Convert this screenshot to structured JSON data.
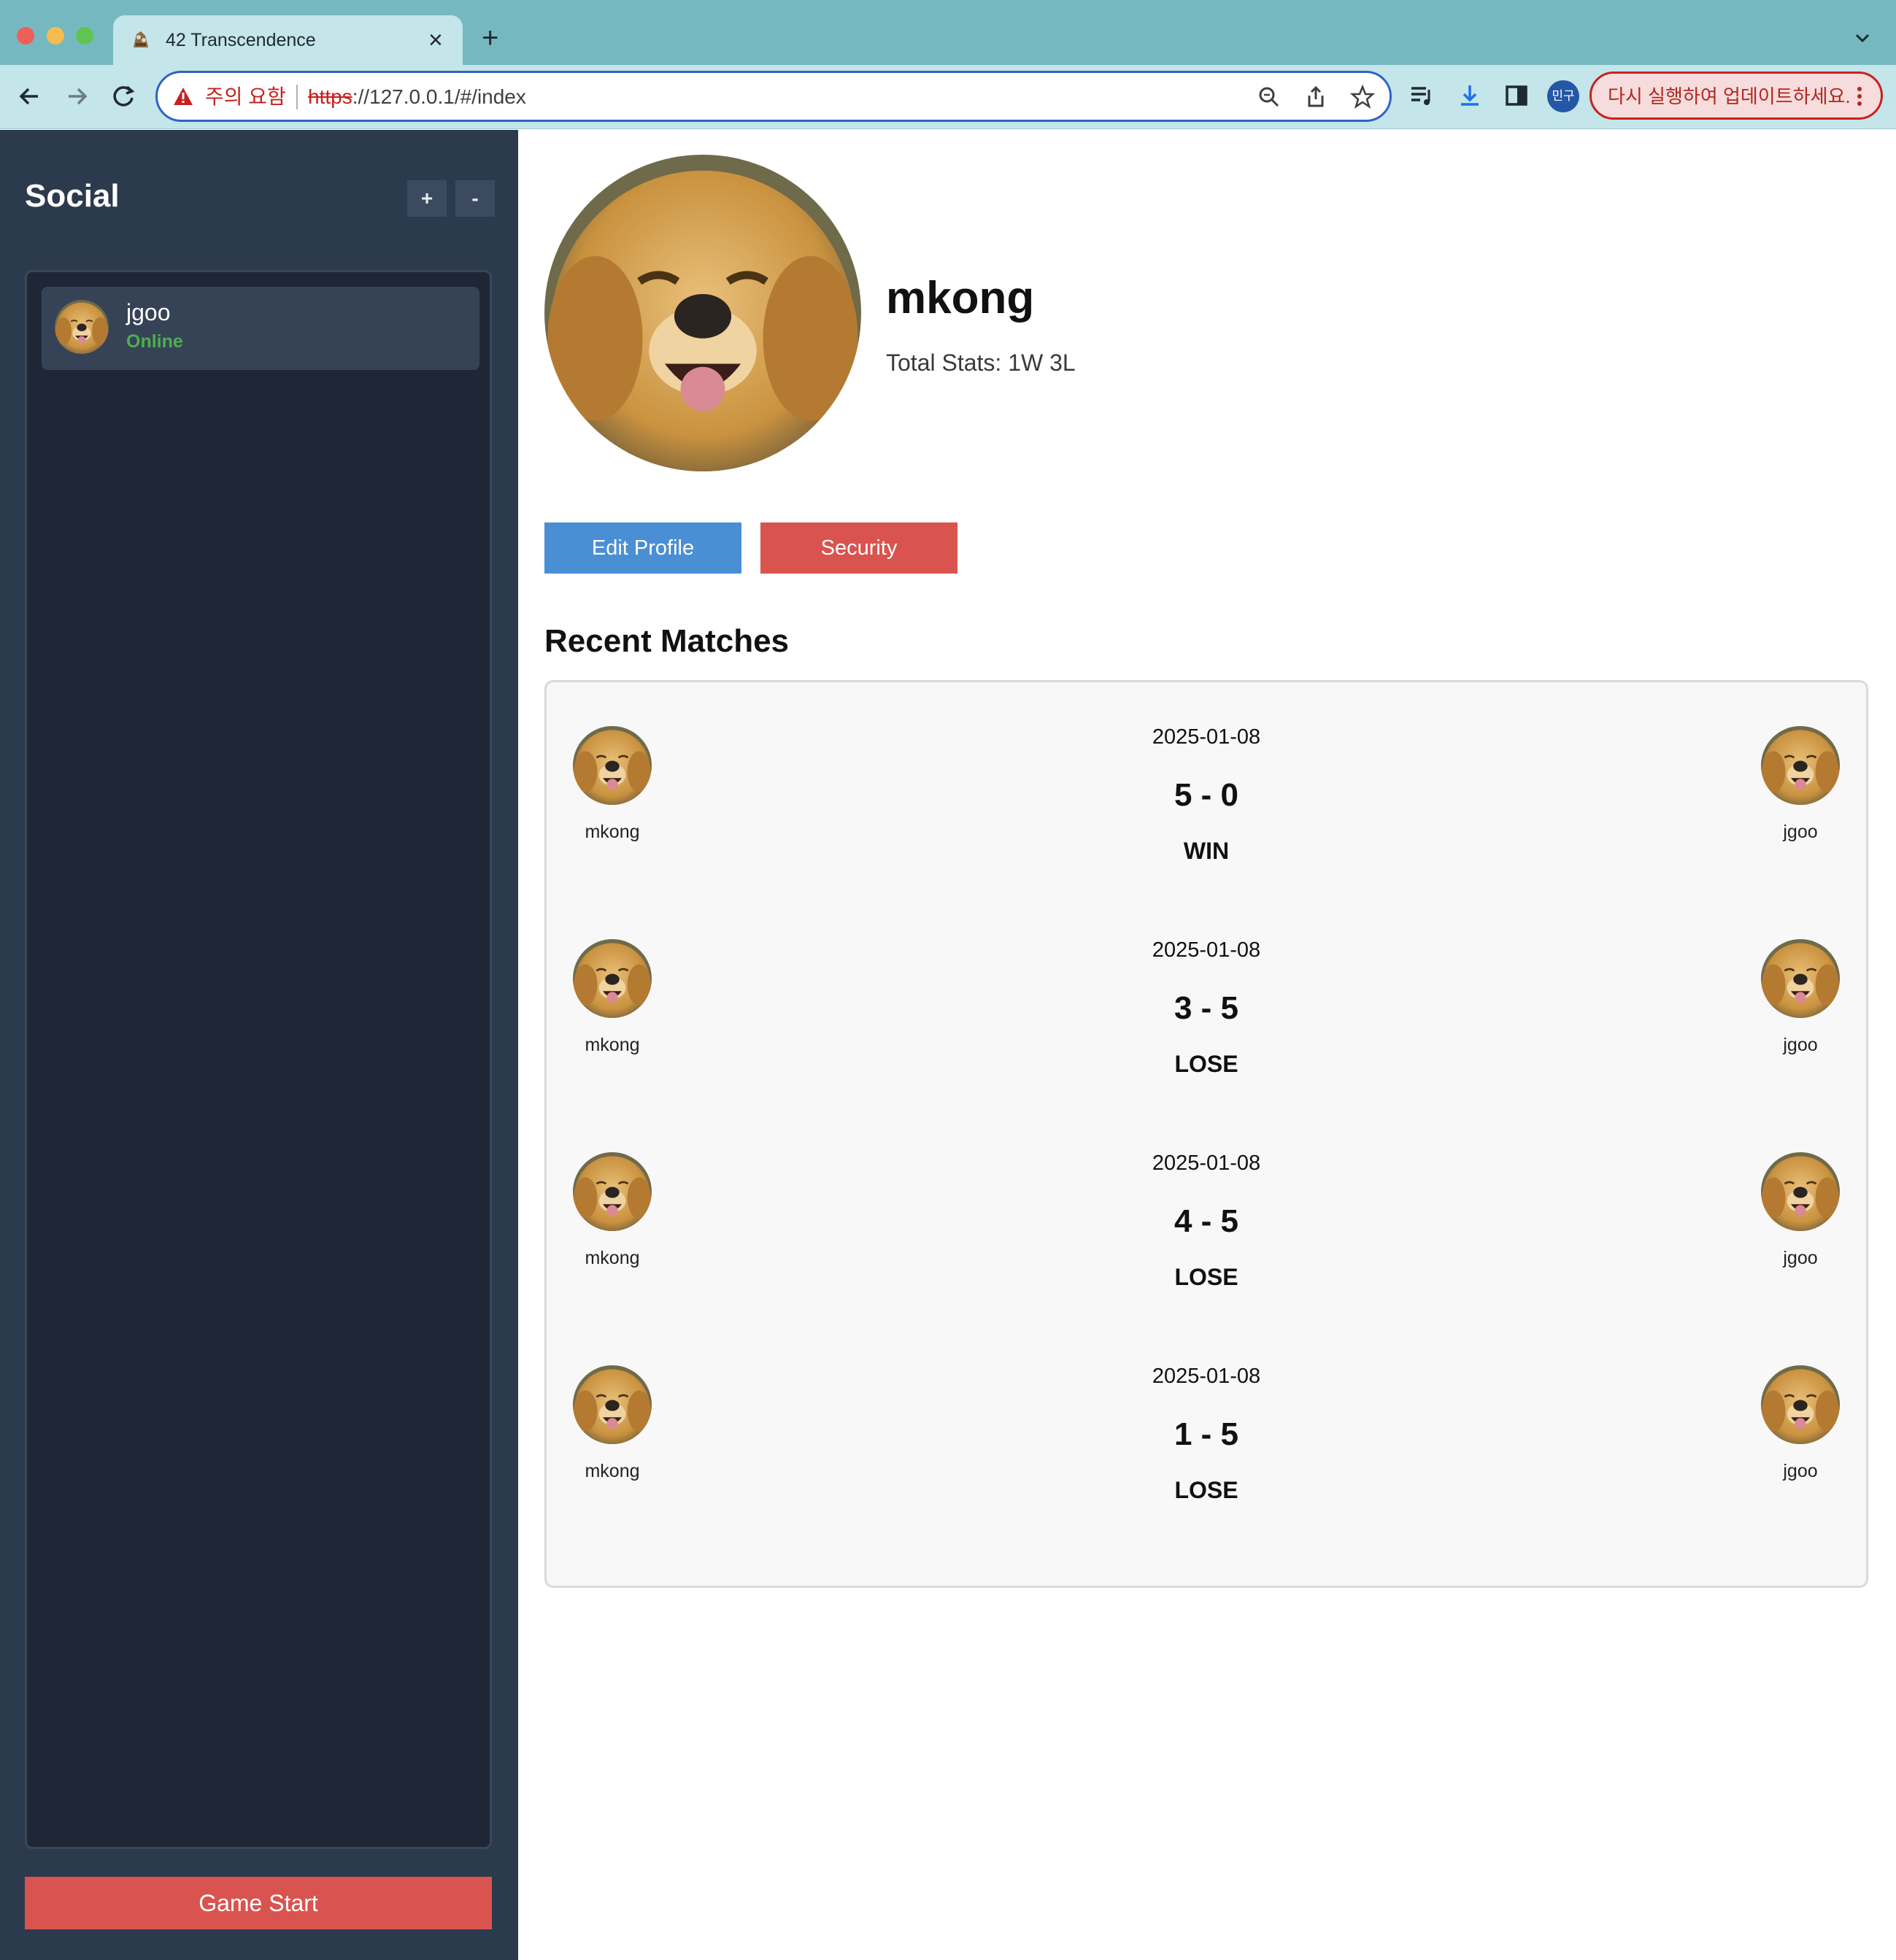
{
  "browser": {
    "tab_title": "42 Transcendence",
    "address": {
      "warning_label": "주의 요함",
      "scheme": "https",
      "rest": "://127.0.0.1/#/index"
    },
    "profile_badge": "민구",
    "update_button": "다시 실행하여 업데이트하세요."
  },
  "sidebar": {
    "title": "Social",
    "add_label": "+",
    "remove_label": "-",
    "friends": [
      {
        "name": "jgoo",
        "status": "Online"
      }
    ],
    "game_start": "Game Start"
  },
  "profile": {
    "username": "mkong",
    "total_stats": "Total Stats: 1W 3L",
    "edit_profile": "Edit Profile",
    "security": "Security"
  },
  "recent_matches": {
    "title": "Recent Matches",
    "matches": [
      {
        "date": "2025-01-08",
        "score": "5 - 0",
        "result": "WIN",
        "player": "mkong",
        "opponent": "jgoo"
      },
      {
        "date": "2025-01-08",
        "score": "3 - 5",
        "result": "LOSE",
        "player": "mkong",
        "opponent": "jgoo"
      },
      {
        "date": "2025-01-08",
        "score": "4 - 5",
        "result": "LOSE",
        "player": "mkong",
        "opponent": "jgoo"
      },
      {
        "date": "2025-01-08",
        "score": "1 - 5",
        "result": "LOSE",
        "player": "mkong",
        "opponent": "jgoo"
      }
    ]
  },
  "colors": {
    "sidebar_bg": "#2c3a4e",
    "online": "#4caf50",
    "edit_button": "#4a8fd4",
    "danger_button": "#d9534f"
  }
}
